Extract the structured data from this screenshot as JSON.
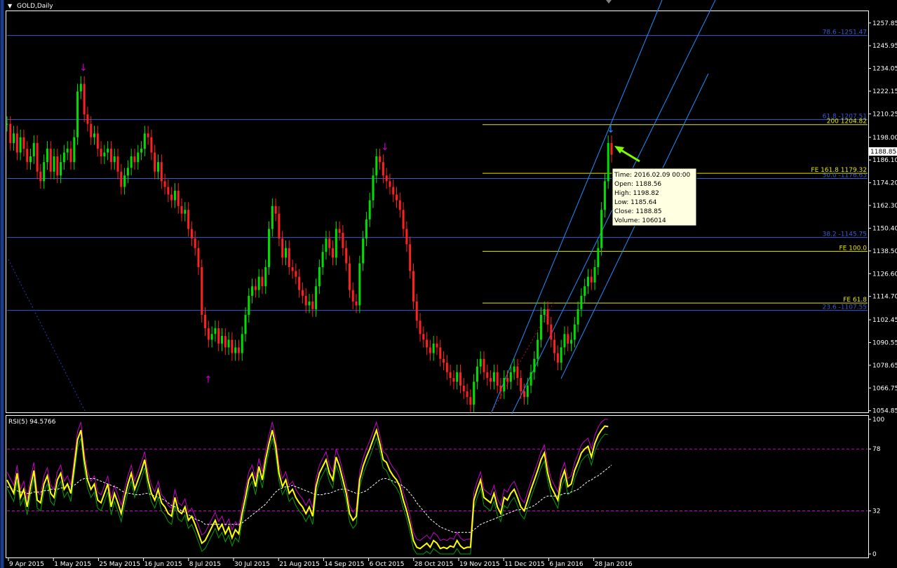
{
  "window": {
    "symbol_title": "GOLD,Daily"
  },
  "colors": {
    "background": "#000000",
    "frame": "#ffffff",
    "candle_up": "#00e000",
    "candle_down": "#ff2020",
    "fib_line": "#3c5ad2",
    "fe_line": "#e6e600",
    "channel": "#1e90ff",
    "arrow_up": "#c800c8",
    "arrow_down": "#c800c8",
    "arrow_latest": "#1e90ff",
    "annotation_arrow": "#7cfc00",
    "rsi_main": "#ffff00",
    "rsi_fast": "#c800c8",
    "rsi_slow": "#00a000",
    "rsi_signal": "#ffffff",
    "rsi_level": "#c800c8",
    "tooltip_bg": "#ffffe1"
  },
  "chart_data": [
    {
      "type": "candlestick",
      "title": "GOLD,Daily",
      "x_tick_labels": [
        "9 Apr 2015",
        "1 May 2015",
        "25 May 2015",
        "16 Jun 2015",
        "8 Jul 2015",
        "30 Jul 2015",
        "21 Aug 2015",
        "14 Sep 2015",
        "6 Oct 2015",
        "28 Oct 2015",
        "19 Nov 2015",
        "11 Dec 2015",
        "6 Jan 2016",
        "28 Jan 2016"
      ],
      "y_tick_labels": [
        "1257.85",
        "1245.95",
        "1234.05",
        "1222.15",
        "1210.25",
        "1198.00",
        "1186.10",
        "1174.20",
        "1162.30",
        "1150.40",
        "1138.50",
        "1126.60",
        "1114.70",
        "1102.45",
        "1090.55",
        "1078.65",
        "1066.75",
        "1054.85"
      ],
      "ylim": [
        1054.0,
        1264.0
      ],
      "current_price": "1188.85",
      "approx_close_series": [
        1205,
        1195,
        1200,
        1190,
        1198,
        1192,
        1185,
        1188,
        1195,
        1180,
        1175,
        1185,
        1192,
        1180,
        1188,
        1178,
        1185,
        1190,
        1192,
        1185,
        1198,
        1222,
        1226,
        1210,
        1205,
        1198,
        1200,
        1192,
        1188,
        1190,
        1192,
        1185,
        1188,
        1180,
        1172,
        1178,
        1182,
        1188,
        1185,
        1190,
        1192,
        1200,
        1198,
        1190,
        1180,
        1185,
        1175,
        1172,
        1168,
        1165,
        1170,
        1162,
        1158,
        1160,
        1150,
        1145,
        1140,
        1130,
        1105,
        1098,
        1092,
        1095,
        1098,
        1090,
        1094,
        1088,
        1092,
        1085,
        1088,
        1085,
        1095,
        1105,
        1115,
        1120,
        1118,
        1125,
        1120,
        1130,
        1150,
        1162,
        1158,
        1145,
        1135,
        1140,
        1130,
        1128,
        1125,
        1118,
        1115,
        1110,
        1112,
        1108,
        1120,
        1130,
        1138,
        1145,
        1140,
        1135,
        1150,
        1148,
        1140,
        1132,
        1118,
        1112,
        1110,
        1132,
        1145,
        1155,
        1165,
        1178,
        1188,
        1185,
        1178,
        1175,
        1172,
        1168,
        1165,
        1160,
        1150,
        1142,
        1128,
        1112,
        1102,
        1095,
        1092,
        1088,
        1085,
        1090,
        1088,
        1082,
        1080,
        1075,
        1072,
        1070,
        1075,
        1068,
        1065,
        1062,
        1058,
        1070,
        1078,
        1082,
        1075,
        1072,
        1070,
        1075,
        1068,
        1065,
        1072,
        1070,
        1075,
        1078,
        1072,
        1065,
        1062,
        1068,
        1075,
        1082,
        1092,
        1105,
        1108,
        1100,
        1092,
        1085,
        1080,
        1088,
        1095,
        1090,
        1092,
        1100,
        1108,
        1115,
        1120,
        1125,
        1122,
        1130,
        1140,
        1160,
        1175,
        1195,
        1188.85
      ],
      "horizontal_levels": [
        {
          "label": "78.6 -1251.47",
          "value": 1251.47,
          "kind": "fib"
        },
        {
          "label": "61.8 -1207.51",
          "value": 1207.51,
          "kind": "fib"
        },
        {
          "label": "200 1204.82",
          "value": 1204.82,
          "kind": "fe"
        },
        {
          "label": "FE 161.8 1179.32",
          "value": 1179.32,
          "kind": "fe"
        },
        {
          "label": "50.0 -1176.63",
          "value": 1176.63,
          "kind": "fib"
        },
        {
          "label": "38.2 -1145.75",
          "value": 1145.75,
          "kind": "fib"
        },
        {
          "label": "FE 100.0",
          "value": 1138.5,
          "kind": "fe"
        },
        {
          "label": "FE 61.8",
          "value": 1111.4,
          "kind": "fe"
        },
        {
          "label": "23.6 -1107.55",
          "value": 1107.55,
          "kind": "fib"
        }
      ],
      "tooltip": {
        "time": "Time: 2016.02.09 00:00",
        "open": "Open: 1188.56",
        "high": "High: 1198.82",
        "low": "Low:  1185.64",
        "close": "Close: 1188.85",
        "volume": "Volume: 106014"
      }
    },
    {
      "type": "line",
      "title": "RSI(5) 94.5766",
      "ylim": [
        0,
        100
      ],
      "y_tick_labels": [
        "100",
        "78",
        "32",
        "0"
      ],
      "levels": [
        78,
        32
      ],
      "approx_rsi_series": [
        55,
        50,
        45,
        60,
        42,
        48,
        35,
        50,
        62,
        40,
        38,
        52,
        58,
        45,
        42,
        55,
        60,
        48,
        52,
        45,
        65,
        85,
        92,
        70,
        55,
        48,
        52,
        40,
        38,
        45,
        52,
        35,
        45,
        38,
        30,
        42,
        52,
        60,
        48,
        55,
        62,
        70,
        55,
        45,
        40,
        48,
        38,
        35,
        30,
        28,
        42,
        32,
        30,
        35,
        25,
        28,
        22,
        15,
        8,
        10,
        15,
        20,
        25,
        18,
        22,
        15,
        20,
        12,
        18,
        15,
        30,
        42,
        55,
        60,
        50,
        65,
        55,
        70,
        82,
        92,
        80,
        60,
        50,
        55,
        45,
        48,
        42,
        38,
        35,
        30,
        35,
        28,
        50,
        60,
        65,
        70,
        60,
        55,
        72,
        65,
        55,
        45,
        30,
        25,
        28,
        55,
        65,
        72,
        78,
        85,
        92,
        82,
        70,
        68,
        62,
        58,
        55,
        50,
        40,
        32,
        22,
        10,
        5,
        4,
        6,
        8,
        5,
        10,
        8,
        4,
        5,
        4,
        6,
        5,
        10,
        6,
        4,
        5,
        5,
        40,
        48,
        55,
        42,
        40,
        38,
        45,
        35,
        30,
        42,
        40,
        45,
        48,
        42,
        35,
        32,
        40,
        48,
        55,
        62,
        70,
        75,
        60,
        50,
        45,
        40,
        55,
        62,
        50,
        52,
        62,
        68,
        75,
        78,
        80,
        72,
        82,
        88,
        92,
        95,
        94.58
      ],
      "approx_signal_series": [
        50,
        49,
        48,
        47,
        46,
        46,
        45,
        45,
        46,
        46,
        46,
        47,
        47,
        48,
        48,
        48,
        49,
        49,
        50,
        50,
        51,
        53,
        55,
        56,
        56,
        56,
        56,
        55,
        54,
        53,
        52,
        51,
        50,
        49,
        47,
        46,
        45,
        45,
        44,
        44,
        44,
        45,
        45,
        44,
        43,
        42,
        41,
        40,
        38,
        36,
        35,
        34,
        32,
        31,
        29,
        28,
        26,
        25,
        24,
        22,
        22,
        22,
        22,
        22,
        22,
        22,
        22,
        22,
        22,
        22,
        23,
        25,
        27,
        29,
        31,
        33,
        35,
        37,
        40,
        43,
        46,
        48,
        49,
        50,
        50,
        51,
        50,
        49,
        48,
        47,
        46,
        45,
        44,
        44,
        44,
        45,
        45,
        46,
        47,
        48,
        48,
        48,
        47,
        46,
        45,
        45,
        46,
        47,
        49,
        51,
        53,
        55,
        56,
        56,
        55,
        54,
        53,
        52,
        50,
        48,
        45,
        42,
        38,
        35,
        32,
        29,
        26,
        24,
        22,
        20,
        19,
        18,
        17,
        16,
        16,
        16,
        16,
        16,
        16,
        18,
        20,
        22,
        23,
        24,
        25,
        26,
        27,
        28,
        29,
        30,
        31,
        32,
        33,
        33,
        33,
        34,
        35,
        36,
        38,
        40,
        42,
        43,
        43,
        43,
        43,
        44,
        45,
        45,
        46,
        47,
        48,
        50,
        52,
        54,
        55,
        57,
        58,
        60,
        62,
        64,
        66
      ]
    }
  ]
}
